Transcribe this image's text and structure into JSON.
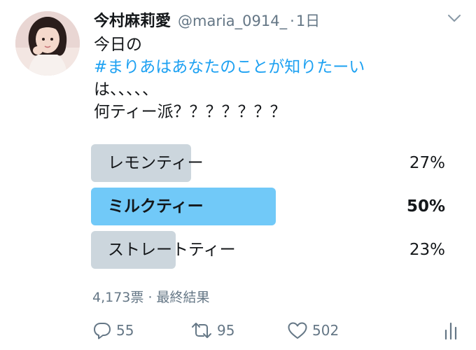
{
  "tweet": {
    "author": {
      "display_name": "今村麻莉愛",
      "handle": "@maria_0914_",
      "time": "1日",
      "separator": "·"
    },
    "text_lines": [
      "今日の",
      "#まりあはあなたのことが知りたーい",
      "は、、、、、",
      "何ティー派？？？？？？？"
    ],
    "poll": {
      "options": [
        {
          "label": "レモンティー",
          "percent_text": "27%",
          "percent": 27
        },
        {
          "label": "ミルクティー",
          "percent_text": "50%",
          "percent": 50,
          "winner": true
        },
        {
          "label": "ストレートティー",
          "percent_text": "23%",
          "percent": 23
        }
      ],
      "votes_text": "4,173票",
      "separator": "·",
      "status_text": "最終結果"
    },
    "actions": {
      "reply_count": "55",
      "retweet_count": "95",
      "like_count": "502"
    }
  },
  "colors": {
    "hashtag": "#1da1f2",
    "winner_bar": "#71c9f8",
    "bar": "#ccd6dd",
    "secondary_text": "#657786"
  },
  "icons": {
    "caret": "chevron-down-icon",
    "reply": "reply-icon",
    "retweet": "retweet-icon",
    "like": "heart-icon",
    "analytics": "analytics-icon"
  }
}
